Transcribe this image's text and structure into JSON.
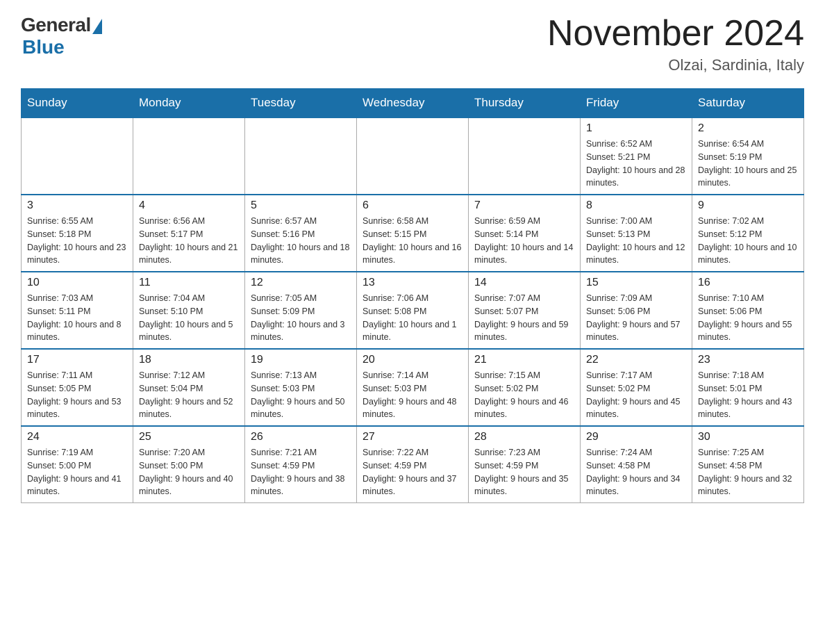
{
  "header": {
    "logo_general": "General",
    "logo_blue": "Blue",
    "month_year": "November 2024",
    "location": "Olzai, Sardinia, Italy"
  },
  "days_of_week": [
    "Sunday",
    "Monday",
    "Tuesday",
    "Wednesday",
    "Thursday",
    "Friday",
    "Saturday"
  ],
  "weeks": [
    [
      {
        "day": "",
        "info": ""
      },
      {
        "day": "",
        "info": ""
      },
      {
        "day": "",
        "info": ""
      },
      {
        "day": "",
        "info": ""
      },
      {
        "day": "",
        "info": ""
      },
      {
        "day": "1",
        "info": "Sunrise: 6:52 AM\nSunset: 5:21 PM\nDaylight: 10 hours and 28 minutes."
      },
      {
        "day": "2",
        "info": "Sunrise: 6:54 AM\nSunset: 5:19 PM\nDaylight: 10 hours and 25 minutes."
      }
    ],
    [
      {
        "day": "3",
        "info": "Sunrise: 6:55 AM\nSunset: 5:18 PM\nDaylight: 10 hours and 23 minutes."
      },
      {
        "day": "4",
        "info": "Sunrise: 6:56 AM\nSunset: 5:17 PM\nDaylight: 10 hours and 21 minutes."
      },
      {
        "day": "5",
        "info": "Sunrise: 6:57 AM\nSunset: 5:16 PM\nDaylight: 10 hours and 18 minutes."
      },
      {
        "day": "6",
        "info": "Sunrise: 6:58 AM\nSunset: 5:15 PM\nDaylight: 10 hours and 16 minutes."
      },
      {
        "day": "7",
        "info": "Sunrise: 6:59 AM\nSunset: 5:14 PM\nDaylight: 10 hours and 14 minutes."
      },
      {
        "day": "8",
        "info": "Sunrise: 7:00 AM\nSunset: 5:13 PM\nDaylight: 10 hours and 12 minutes."
      },
      {
        "day": "9",
        "info": "Sunrise: 7:02 AM\nSunset: 5:12 PM\nDaylight: 10 hours and 10 minutes."
      }
    ],
    [
      {
        "day": "10",
        "info": "Sunrise: 7:03 AM\nSunset: 5:11 PM\nDaylight: 10 hours and 8 minutes."
      },
      {
        "day": "11",
        "info": "Sunrise: 7:04 AM\nSunset: 5:10 PM\nDaylight: 10 hours and 5 minutes."
      },
      {
        "day": "12",
        "info": "Sunrise: 7:05 AM\nSunset: 5:09 PM\nDaylight: 10 hours and 3 minutes."
      },
      {
        "day": "13",
        "info": "Sunrise: 7:06 AM\nSunset: 5:08 PM\nDaylight: 10 hours and 1 minute."
      },
      {
        "day": "14",
        "info": "Sunrise: 7:07 AM\nSunset: 5:07 PM\nDaylight: 9 hours and 59 minutes."
      },
      {
        "day": "15",
        "info": "Sunrise: 7:09 AM\nSunset: 5:06 PM\nDaylight: 9 hours and 57 minutes."
      },
      {
        "day": "16",
        "info": "Sunrise: 7:10 AM\nSunset: 5:06 PM\nDaylight: 9 hours and 55 minutes."
      }
    ],
    [
      {
        "day": "17",
        "info": "Sunrise: 7:11 AM\nSunset: 5:05 PM\nDaylight: 9 hours and 53 minutes."
      },
      {
        "day": "18",
        "info": "Sunrise: 7:12 AM\nSunset: 5:04 PM\nDaylight: 9 hours and 52 minutes."
      },
      {
        "day": "19",
        "info": "Sunrise: 7:13 AM\nSunset: 5:03 PM\nDaylight: 9 hours and 50 minutes."
      },
      {
        "day": "20",
        "info": "Sunrise: 7:14 AM\nSunset: 5:03 PM\nDaylight: 9 hours and 48 minutes."
      },
      {
        "day": "21",
        "info": "Sunrise: 7:15 AM\nSunset: 5:02 PM\nDaylight: 9 hours and 46 minutes."
      },
      {
        "day": "22",
        "info": "Sunrise: 7:17 AM\nSunset: 5:02 PM\nDaylight: 9 hours and 45 minutes."
      },
      {
        "day": "23",
        "info": "Sunrise: 7:18 AM\nSunset: 5:01 PM\nDaylight: 9 hours and 43 minutes."
      }
    ],
    [
      {
        "day": "24",
        "info": "Sunrise: 7:19 AM\nSunset: 5:00 PM\nDaylight: 9 hours and 41 minutes."
      },
      {
        "day": "25",
        "info": "Sunrise: 7:20 AM\nSunset: 5:00 PM\nDaylight: 9 hours and 40 minutes."
      },
      {
        "day": "26",
        "info": "Sunrise: 7:21 AM\nSunset: 4:59 PM\nDaylight: 9 hours and 38 minutes."
      },
      {
        "day": "27",
        "info": "Sunrise: 7:22 AM\nSunset: 4:59 PM\nDaylight: 9 hours and 37 minutes."
      },
      {
        "day": "28",
        "info": "Sunrise: 7:23 AM\nSunset: 4:59 PM\nDaylight: 9 hours and 35 minutes."
      },
      {
        "day": "29",
        "info": "Sunrise: 7:24 AM\nSunset: 4:58 PM\nDaylight: 9 hours and 34 minutes."
      },
      {
        "day": "30",
        "info": "Sunrise: 7:25 AM\nSunset: 4:58 PM\nDaylight: 9 hours and 32 minutes."
      }
    ]
  ]
}
